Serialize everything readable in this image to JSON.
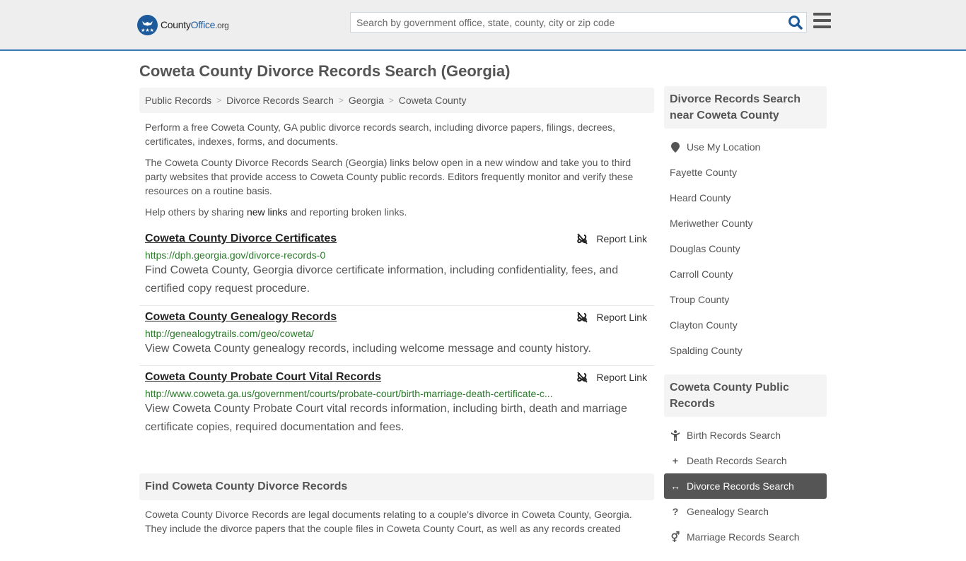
{
  "header": {
    "logo": {
      "prefix": "County",
      "accent": "Office",
      "suffix": ".org"
    },
    "search_placeholder": "Search by government office, state, county, city or zip code",
    "search_value": "",
    "accent_color": "#1d5a9c"
  },
  "page_title": "Coweta County Divorce Records Search (Georgia)",
  "breadcrumb": [
    "Public Records",
    "Divorce Records Search",
    "Georgia",
    "Coweta County"
  ],
  "intro": {
    "p1": "Perform a free Coweta County, GA public divorce records search, including divorce papers, filings, decrees, certificates, indexes, forms, and documents.",
    "p2": "The Coweta County Divorce Records Search (Georgia) links below open in a new window and take you to third party websites that provide access to Coweta County public records. Editors frequently monitor and verify these resources on a routine basis.",
    "p3_before": "Help others by sharing ",
    "p3_link": "new links",
    "p3_after": " and reporting broken links."
  },
  "results": [
    {
      "title": "Coweta County Divorce Certificates",
      "url": "https://dph.georgia.gov/divorce-records-0",
      "description": "Find Coweta County, Georgia divorce certificate information, including confidentiality, fees, and certified copy request procedure.",
      "report_label": "Report Link"
    },
    {
      "title": "Coweta County Genealogy Records",
      "url": "http://genealogytrails.com/geo/coweta/",
      "description": "View Coweta County genealogy records, including welcome message and county history.",
      "report_label": "Report Link"
    },
    {
      "title": "Coweta County Probate Court Vital Records",
      "url": "http://www.coweta.ga.us/government/courts/probate-court/birth-marriage-death-certificate-c...",
      "description": "View Coweta County Probate Court vital records information, including birth, death and marriage certificate copies, required documentation and fees.",
      "report_label": "Report Link"
    }
  ],
  "find_section": {
    "title": "Find Coweta County Divorce Records",
    "body": "Coweta County Divorce Records are legal documents relating to a couple's divorce in Coweta County, Georgia. They include the divorce papers that the couple files in Coweta County Court, as well as any records created"
  },
  "sidebar": {
    "nearby": {
      "title": "Divorce Records Search near Coweta County",
      "use_location": "Use My Location",
      "counties": [
        "Fayette County",
        "Heard County",
        "Meriwether County",
        "Douglas County",
        "Carroll County",
        "Troup County",
        "Clayton County",
        "Spalding County"
      ]
    },
    "public_records": {
      "title": "Coweta County Public Records",
      "items": [
        {
          "label": "Birth Records Search",
          "icon": "child-icon",
          "glyph": "†",
          "active": false
        },
        {
          "label": "Death Records Search",
          "icon": "plus-icon",
          "glyph": "+",
          "active": false
        },
        {
          "label": "Divorce Records Search",
          "icon": "arrows-horizontal-icon",
          "glyph": "↔",
          "active": true
        },
        {
          "label": "Genealogy Search",
          "icon": "question-icon",
          "glyph": "?",
          "active": false
        },
        {
          "label": "Marriage Records Search",
          "icon": "venus-mars-icon",
          "glyph": "⚥",
          "active": false
        }
      ]
    }
  }
}
